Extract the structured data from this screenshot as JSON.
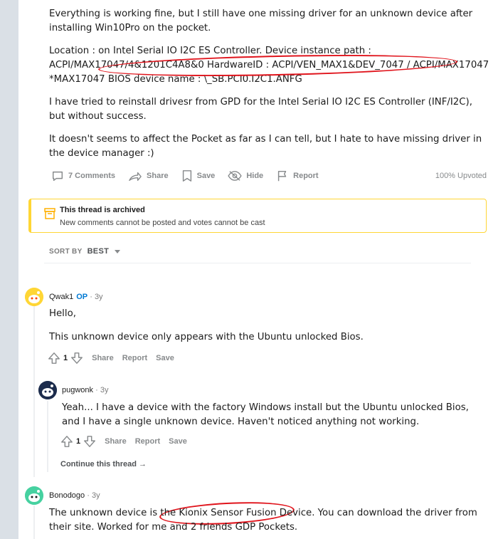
{
  "post": {
    "paragraphs": [
      "Everything is working fine, but I still have one missing driver for an unknown device after installing Win10Pro on the pocket.",
      "Location : on Intel Serial IO I2C ES Controller. Device instance path : ACPI/MAX17047/4&1201C4A8&0 HardwareID : ACPI/VEN_MAX1&DEV_7047 / ACPI/MAX17047 *MAX17047 BIOS device name : \\_SB.PCI0.I2C1.ANFG",
      "I have tried to reinstall drivesr from GPD for the Intel Serial IO I2C ES Controller (INF/I2C), but without success.",
      "It doesn't seems to affect the Pocket as far as I can tell, but I hate to have missing driver in the device manager :)"
    ]
  },
  "actions": {
    "comments": "7 Comments",
    "share": "Share",
    "save": "Save",
    "hide": "Hide",
    "report": "Report",
    "upvoted": "100% Upvoted"
  },
  "archived": {
    "title": "This thread is archived",
    "message": "New comments cannot be posted and votes cannot be cast"
  },
  "sort": {
    "label": "SORT BY",
    "value": "BEST"
  },
  "comments": [
    {
      "user": "Qwak1",
      "op": "OP",
      "age": "3y",
      "lines": [
        "Hello,",
        "This unknown device only appears with the Ubuntu unlocked Bios."
      ],
      "score": "1",
      "share": "Share",
      "report": "Report",
      "save": "Save"
    },
    {
      "user": "pugwonk",
      "age": "3y",
      "text": "Yeah... I have a device with the factory Windows install but the Ubuntu unlocked Bios, and I have a single unknown device. Haven't noticed anything not working.",
      "score": "1",
      "share": "Share",
      "report": "Report",
      "save": "Save",
      "continue": "Continue this thread"
    },
    {
      "user": "Bonodogo",
      "age": "3y",
      "text": "The unknown device is the Kionix Sensor Fusion Device. You can download the driver from their site. Worked for me and 2 friends GDP Pockets."
    }
  ],
  "colors": {
    "accent": "#0079d3",
    "archived_border": "#ffd635",
    "annotation": "#e0141c",
    "meta": "#878a8c"
  },
  "icons": {
    "comments": "comment-bubble-icon",
    "share": "share-arrow-icon",
    "save": "bookmark-icon",
    "hide": "eye-slash-icon",
    "report": "flag-icon",
    "archive": "archive-box-icon",
    "upvote": "upvote-arrow-icon",
    "downvote": "downvote-arrow-icon"
  }
}
